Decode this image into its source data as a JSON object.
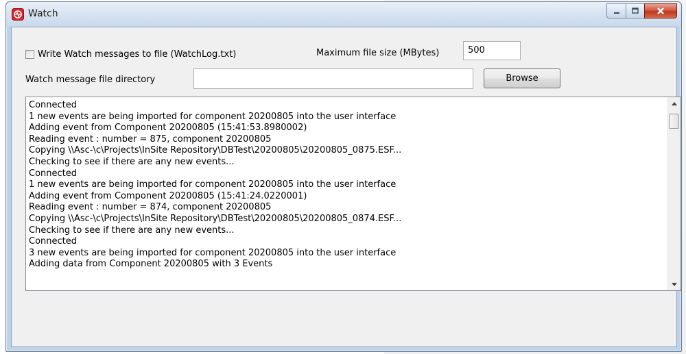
{
  "window": {
    "title": "Watch",
    "icon": "app-logo-icon",
    "controls": {
      "minimize": "–",
      "maximize": "□",
      "close": "X"
    }
  },
  "settings": {
    "write_to_file": {
      "label": "Write Watch messages to file (WatchLog.txt)",
      "checked": false
    },
    "max_file_size": {
      "label": "Maximum file size (MBytes)",
      "value": "500"
    },
    "directory": {
      "label": "Watch message file directory",
      "value": ""
    },
    "browse_label": "Browse"
  },
  "log": {
    "lines": [
      "Connected",
      "1 new events are being imported for component 20200805 into the user interface",
      "Adding event from Component 20200805 (15:41:53.8980002)",
      "Reading event : number = 875, component 20200805",
      "Copying \\\\Asc-\\c\\Projects\\InSite Repository\\DBTest\\20200805\\20200805_0875.ESF...",
      "Checking to see if there are any new events...",
      "Connected",
      "1 new events are being imported for component 20200805 into the user interface",
      "Adding event from Component 20200805 (15:41:24.0220001)",
      "Reading event : number = 874, component 20200805",
      "Copying \\\\Asc-\\c\\Projects\\InSite Repository\\DBTest\\20200805\\20200805_0874.ESF...",
      "Checking to see if there are any new events...",
      "Connected",
      "3 new events are being imported for component 20200805 into the user interface",
      "Adding data from Component 20200805 with 3 Events"
    ]
  },
  "colors": {
    "close_button": "#c0361c",
    "app_icon": "#d8262b",
    "frame": "#bcd3ea"
  }
}
